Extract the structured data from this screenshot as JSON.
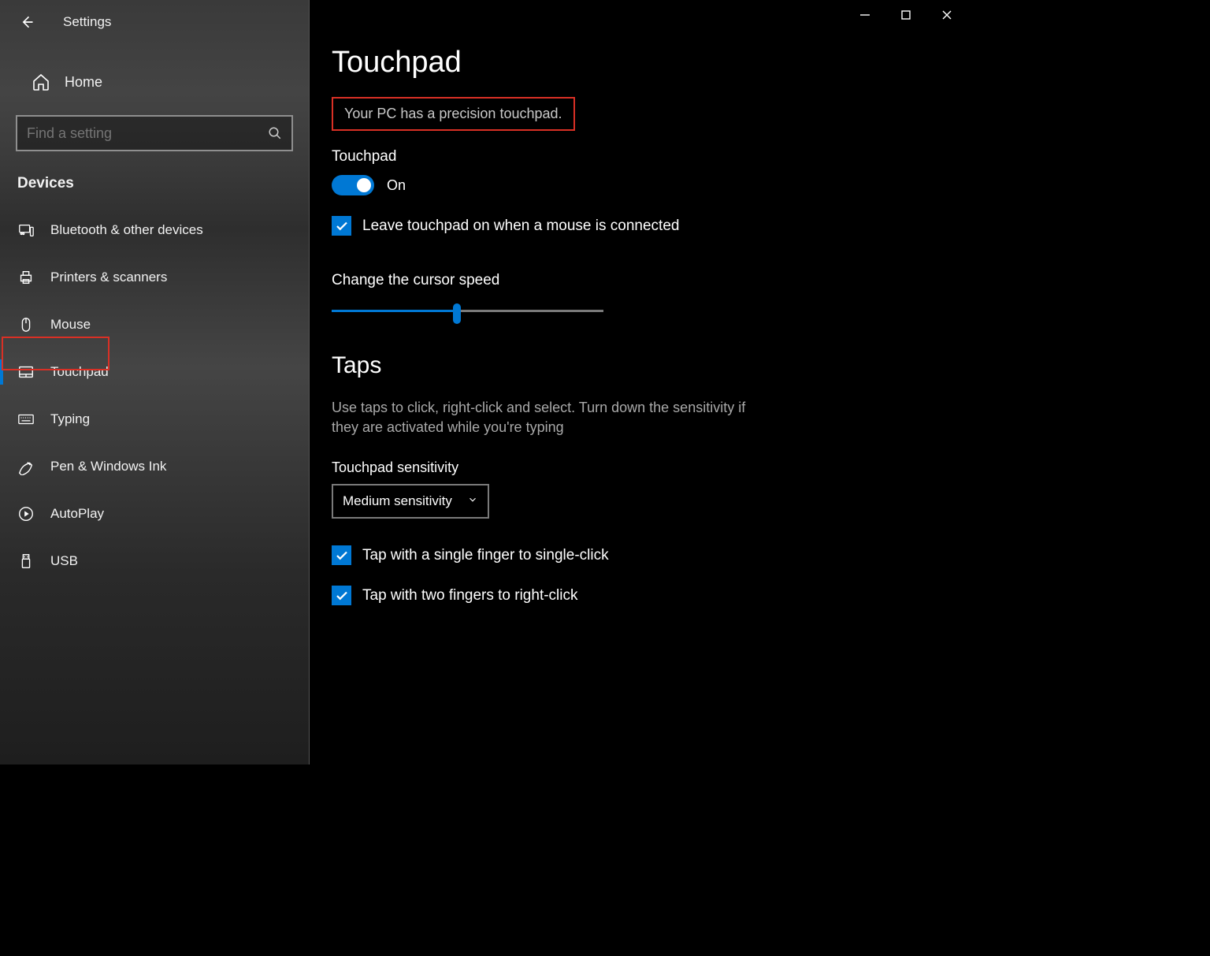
{
  "colors": {
    "accent": "#0078d4",
    "highlight": "#d93025"
  },
  "titlebar": {
    "app_title": "Settings"
  },
  "sidebar": {
    "home_label": "Home",
    "search_placeholder": "Find a setting",
    "section_label": "Devices",
    "items": [
      {
        "icon": "bluetooth-icon",
        "label": "Bluetooth & other devices"
      },
      {
        "icon": "printer-icon",
        "label": "Printers & scanners"
      },
      {
        "icon": "mouse-icon",
        "label": "Mouse"
      },
      {
        "icon": "touchpad-icon",
        "label": "Touchpad",
        "selected": true
      },
      {
        "icon": "keyboard-icon",
        "label": "Typing"
      },
      {
        "icon": "pen-icon",
        "label": "Pen & Windows Ink"
      },
      {
        "icon": "autoplay-icon",
        "label": "AutoPlay"
      },
      {
        "icon": "usb-icon",
        "label": "USB"
      }
    ]
  },
  "main": {
    "page_title": "Touchpad",
    "precision_text": "Your PC has a precision touchpad.",
    "touchpad_label": "Touchpad",
    "toggle_state": "On",
    "leave_on_label": "Leave touchpad on when a mouse is connected",
    "cursor_speed_label": "Change the cursor speed",
    "cursor_speed_percent": 46,
    "taps_heading": "Taps",
    "taps_desc": "Use taps to click, right-click and select. Turn down the sensitivity if they are activated while you're typing",
    "sensitivity_label": "Touchpad sensitivity",
    "sensitivity_value": "Medium sensitivity",
    "tap_single_label": "Tap with a single finger to single-click",
    "tap_two_label": "Tap with two fingers to right-click"
  }
}
